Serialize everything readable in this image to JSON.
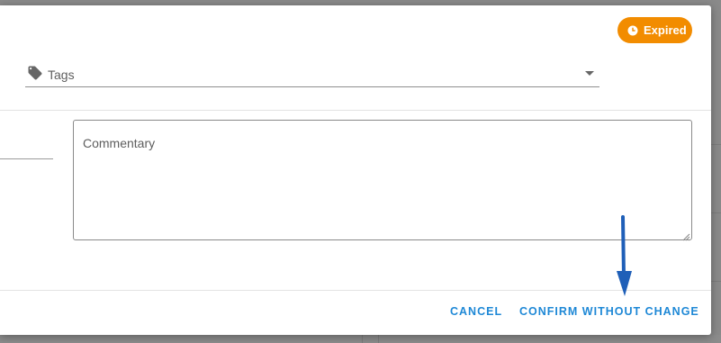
{
  "status_badge": {
    "label": "Expired",
    "icon": "clock-icon",
    "color": "#f28c00"
  },
  "tags_field": {
    "label": "Tags",
    "icon": "tag-icon"
  },
  "commentary": {
    "placeholder": "Commentary"
  },
  "actions": {
    "cancel_label": "CANCEL",
    "confirm_label": "CONFIRM WITHOUT CHANGE",
    "color": "#1e88d6"
  },
  "annotation": {
    "arrow_color": "#1f5fb8"
  }
}
